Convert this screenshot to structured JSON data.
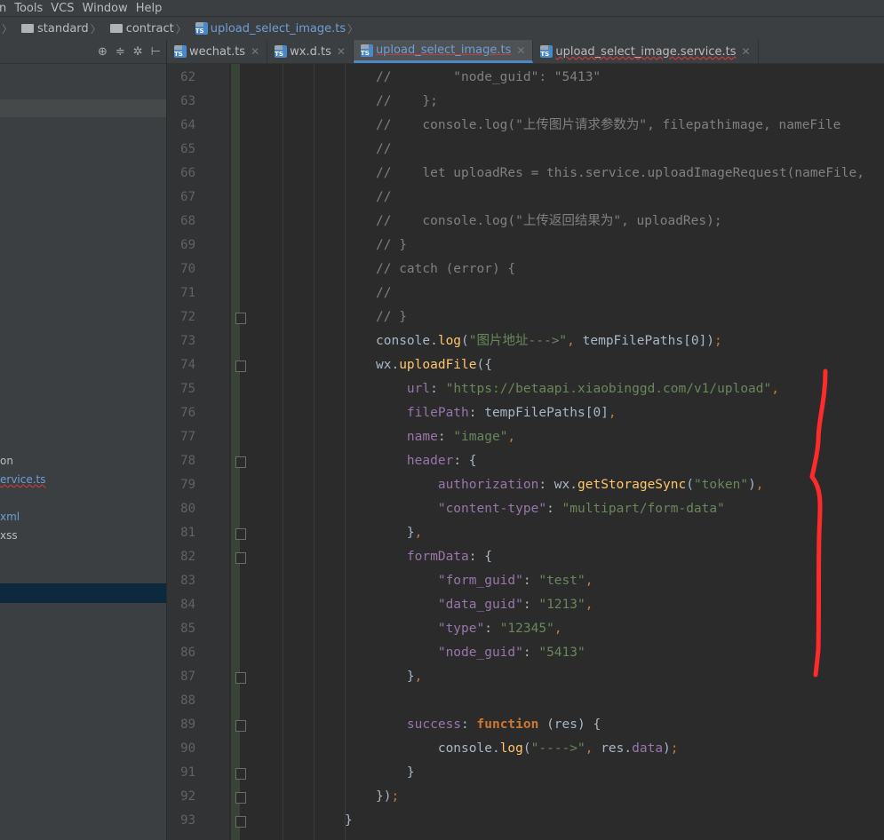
{
  "menu": [
    "n",
    "Tools",
    "VCS",
    "Window",
    "Help"
  ],
  "breadcrumb": [
    {
      "type": "folder",
      "label": "standard"
    },
    {
      "type": "folder",
      "label": "contract"
    },
    {
      "type": "file",
      "label": "upload_select_image.ts"
    }
  ],
  "tabs": [
    {
      "label": "wechat.ts",
      "active": false
    },
    {
      "label": "wx.d.ts",
      "active": false
    },
    {
      "label": "upload_select_image.ts",
      "active": true
    },
    {
      "label": "upload_select_image.service.ts",
      "active": false
    }
  ],
  "sidebar": {
    "toolbar_icons": [
      "⊕",
      "≑",
      "✲",
      "⊢"
    ],
    "rows": [
      {
        "label": "on",
        "color": "#bbbbbb"
      },
      {
        "label": "ervice.ts",
        "color": "#6e9ed6"
      },
      {
        "label": "xml",
        "color": "#6e9ed6"
      },
      {
        "label": "xss",
        "color": "#bbbbbb"
      }
    ]
  },
  "editor": {
    "lines": [
      {
        "n": "62",
        "code": "//        \"node_guid\": \"5413\""
      },
      {
        "n": "63",
        "code": "//    };"
      },
      {
        "n": "64",
        "code": "//    console.log(\"上传图片请求参数为\", filepathimage, nameFile"
      },
      {
        "n": "65",
        "code": "//"
      },
      {
        "n": "66",
        "code": "//    let uploadRes = this.service.uploadImageRequest(nameFile,"
      },
      {
        "n": "67",
        "code": "//"
      },
      {
        "n": "68",
        "code": "//    console.log(\"上传返回结果为\", uploadRes);"
      },
      {
        "n": "69",
        "code": "// }"
      },
      {
        "n": "70",
        "code": "// catch (error) {"
      },
      {
        "n": "71",
        "code": "//"
      },
      {
        "n": "72",
        "code": "// }"
      },
      {
        "n": "73",
        "code": "console.log(\"图片地址--->\", tempFilePaths[0]);"
      },
      {
        "n": "74",
        "code": "wx.uploadFile({"
      },
      {
        "n": "75",
        "code": "    url: \"https://betaapi.xiaobinggd.com/v1/upload\","
      },
      {
        "n": "76",
        "code": "    filePath: tempFilePaths[0],"
      },
      {
        "n": "77",
        "code": "    name: \"image\","
      },
      {
        "n": "78",
        "code": "    header: {"
      },
      {
        "n": "79",
        "code": "        authorization: wx.getStorageSync(\"token\"),"
      },
      {
        "n": "80",
        "code": "        \"content-type\": \"multipart/form-data\""
      },
      {
        "n": "81",
        "code": "    },"
      },
      {
        "n": "82",
        "code": "    formData: {"
      },
      {
        "n": "83",
        "code": "        \"form_guid\": \"test\","
      },
      {
        "n": "84",
        "code": "        \"data_guid\": \"1213\","
      },
      {
        "n": "85",
        "code": "        \"type\": \"12345\","
      },
      {
        "n": "86",
        "code": "        \"node_guid\": \"5413\""
      },
      {
        "n": "87",
        "code": "    },"
      },
      {
        "n": "88",
        "code": ""
      },
      {
        "n": "89",
        "code": "    success: function (res) {"
      },
      {
        "n": "90",
        "code": "        console.log(\"---->\", res.data);"
      },
      {
        "n": "91",
        "code": "    }"
      },
      {
        "n": "92",
        "code": "});"
      },
      {
        "n": "93",
        "code": "}"
      }
    ]
  },
  "colors": {
    "background": "#2b2b2b",
    "comment": "#808080",
    "string": "#6a8759",
    "property": "#9876aa",
    "keyword": "#cc7832",
    "function": "#ffc66d",
    "annotation_mark": "#ff2a2a"
  }
}
